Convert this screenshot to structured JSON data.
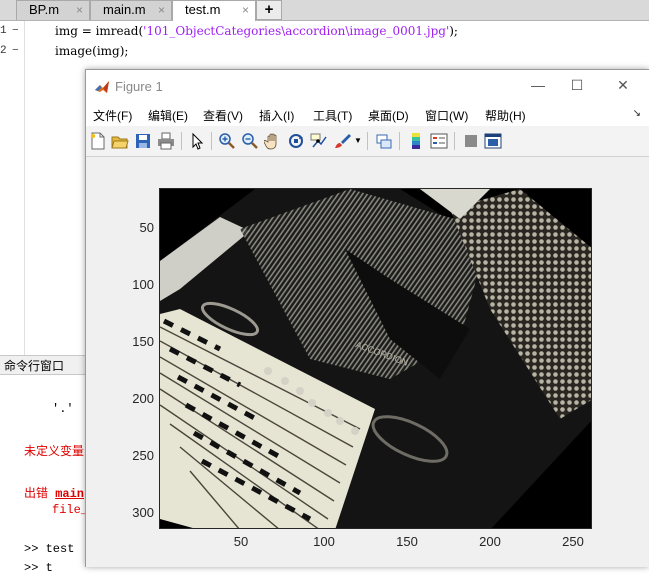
{
  "editor_tabs": [
    {
      "label": "BP.m",
      "close": "×"
    },
    {
      "label": "main.m",
      "close": "×"
    },
    {
      "label": "test.m",
      "close": "×"
    }
  ],
  "add_tab_label": "+",
  "code_lines": [
    {
      "number": "1",
      "dash": "−",
      "pre": "img = imread(",
      "str": "'101_ObjectCategories\\accordion\\image_0001.jpg'",
      "post": ");"
    },
    {
      "number": "2",
      "dash": "−",
      "pre": "image(img);",
      "str": "",
      "post": ""
    }
  ],
  "command_window": {
    "title": "命令行窗口",
    "lines": {
      "quote": "'.'",
      "undefined_var": "未定义变量",
      "error_prefix": "出错 ",
      "error_link": "main",
      "file_line": "file_",
      "prompt": ">> test",
      "prompt2": ">> t"
    }
  },
  "figure": {
    "title": "Figure 1",
    "window_buttons": {
      "minimize": "—",
      "maximize": "☐",
      "close": "✕"
    },
    "menu": [
      "文件(F)",
      "编辑(E)",
      "查看(V)",
      "插入(I)",
      "工具(T)",
      "桌面(D)",
      "窗口(W)",
      "帮助(H)"
    ],
    "menu_overflow": "↘",
    "toolbar_icons": [
      "new-figure-icon",
      "open-file-icon",
      "save-icon",
      "print-icon",
      "edit-plot-arrow-icon",
      "zoom-in-icon",
      "zoom-out-icon",
      "pan-hand-icon",
      "rotate-3d-icon",
      "data-cursor-icon",
      "brush-icon",
      "link-plot-icon",
      "colorbar-icon",
      "legend-icon",
      "hide-plot-tools-icon",
      "show-plot-tools-icon"
    ]
  },
  "axes": {
    "y_ticks": [
      "50",
      "100",
      "150",
      "200",
      "250",
      "300"
    ],
    "x_ticks": [
      "50",
      "100",
      "150",
      "200",
      "250"
    ],
    "x_range": [
      0.5,
      260.5
    ],
    "y_range": [
      0.5,
      300.5
    ]
  },
  "colors": {
    "matlab_orange": "#e16f1e",
    "error_red": "#e00000",
    "string_purple": "#a020f0"
  }
}
